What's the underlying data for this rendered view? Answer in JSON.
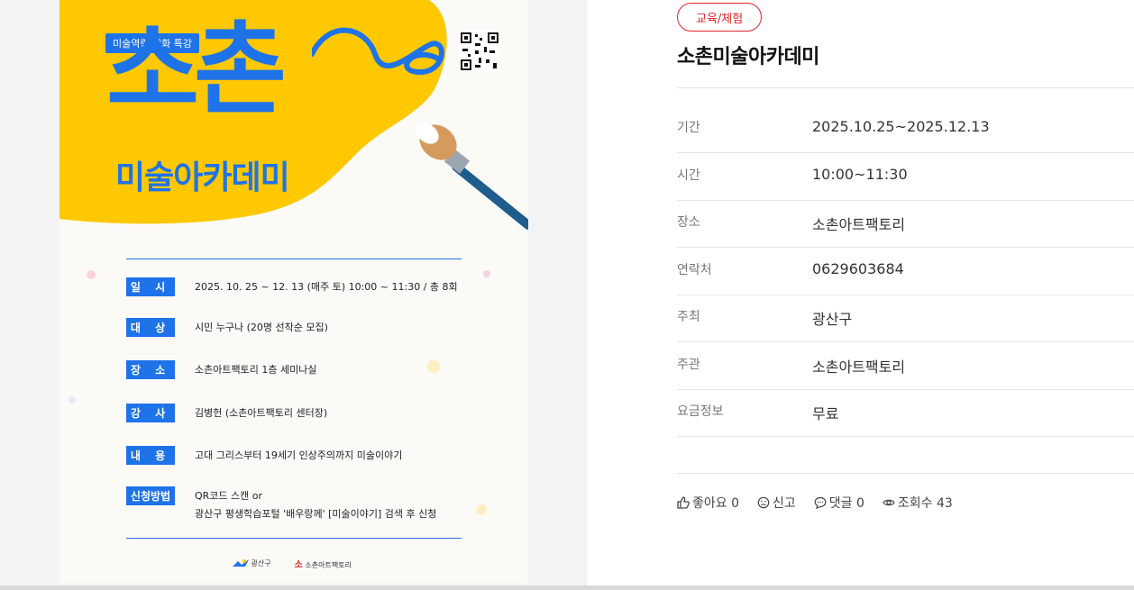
{
  "poster": {
    "badge": "미술역량 강화 특강",
    "big_title": "소촌",
    "sub_title": "미술아카데미",
    "rows": [
      {
        "label": "일 시",
        "value": "2025. 10. 25 ~ 12. 13 (매주 토) 10:00 ~ 11:30 / 총 8회"
      },
      {
        "label": "대 상",
        "value": "시민 누구나  (20명 선착순 모집)"
      },
      {
        "label": "장 소",
        "value": "소촌아트팩토리 1층 세미나실"
      },
      {
        "label": "강 사",
        "value": "김병헌 (소촌아트팩토리 센터장)"
      },
      {
        "label": "내 용",
        "value": "고대 그리스부터 19세기 인상주의까지 미술이야기"
      },
      {
        "label": "신청방법",
        "value": "QR코드 스캔  or",
        "value2": "광산구 평생학습포털 '배우랑께' [미술이야기] 검색 후 신청"
      }
    ],
    "logo_1": "광산구",
    "logo_2": "소촌아트팩토리",
    "colors": {
      "blue": "#1e73e8",
      "yellow": "#ffc800"
    }
  },
  "detail": {
    "category": "교육/체험",
    "title": "소촌미술아카데미",
    "info": [
      {
        "key": "기간",
        "value": "2025.10.25~2025.12.13"
      },
      {
        "key": "시간",
        "value": "10:00~11:30"
      },
      {
        "key": "장소",
        "value": "소촌아트팩토리"
      },
      {
        "key": "연락처",
        "value": "0629603684"
      },
      {
        "key": "주최",
        "value": "광산구"
      },
      {
        "key": "주관",
        "value": "소촌아트팩토리"
      },
      {
        "key": "요금정보",
        "value": "무료"
      }
    ],
    "actions": {
      "like": "좋아요 0",
      "report": "신고",
      "comment": "댓글 0",
      "views": "조회수 43"
    },
    "accent_color": "#e0262b"
  }
}
